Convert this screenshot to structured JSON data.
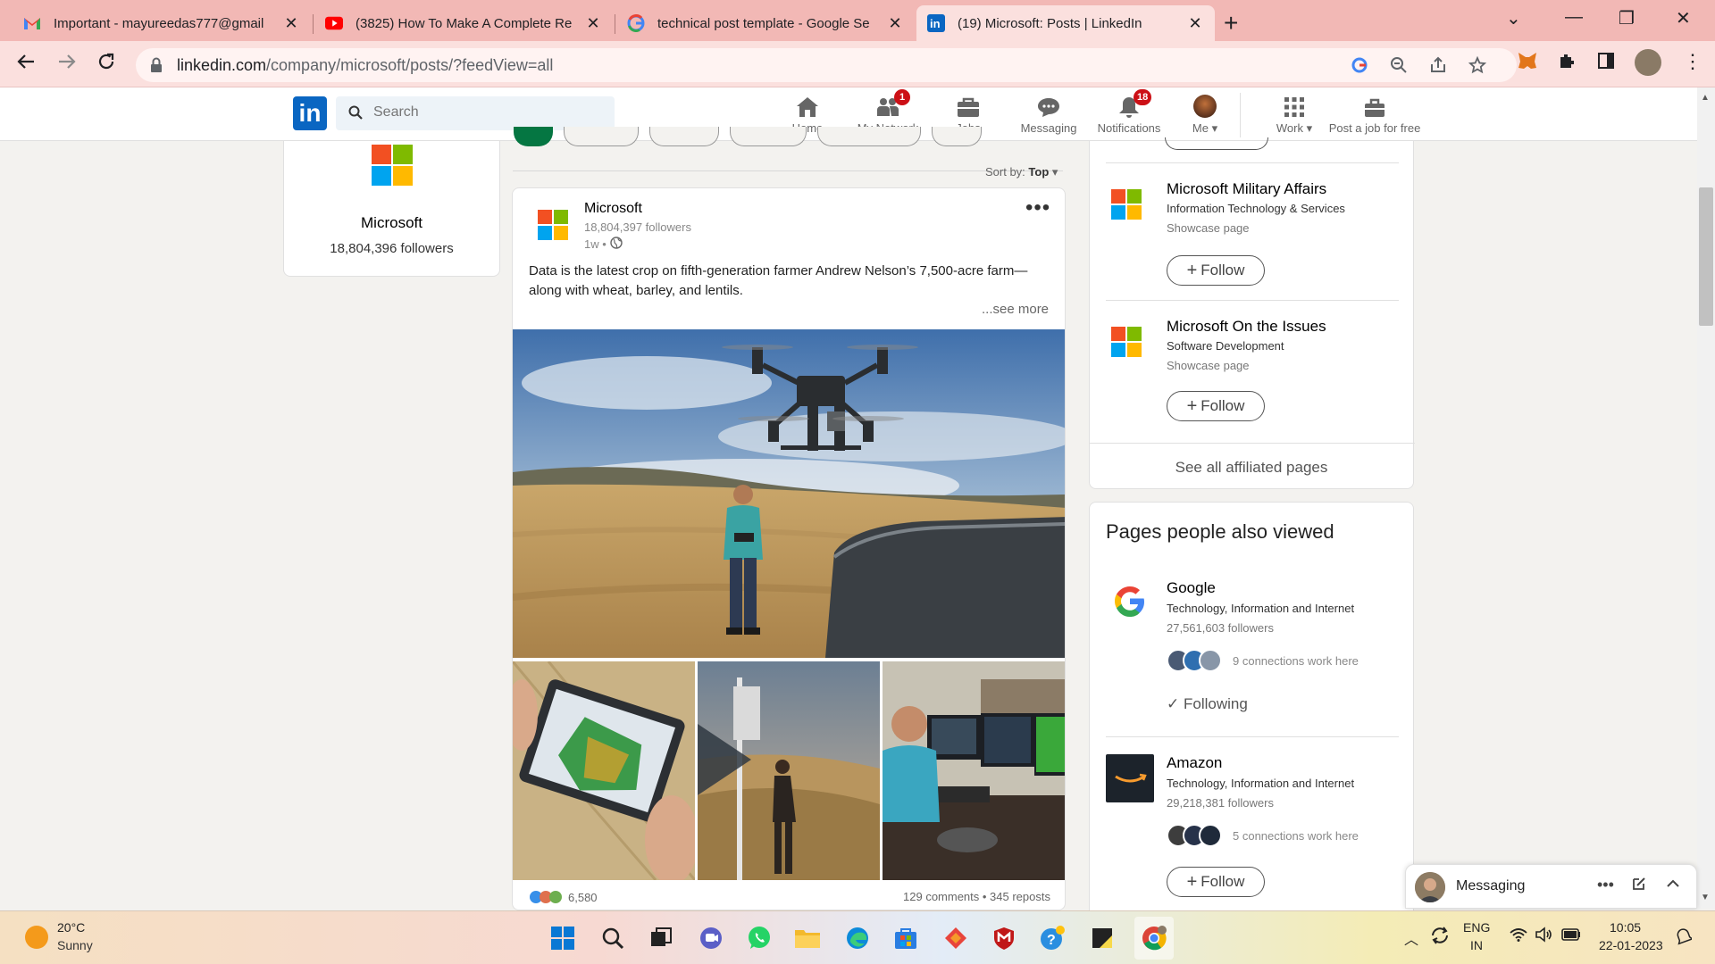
{
  "browser": {
    "tabs": [
      {
        "title": "Important - mayureedas777@gmail",
        "icon": "gmail-icon"
      },
      {
        "title": "(3825) How To Make A Complete Re",
        "icon": "youtube-icon"
      },
      {
        "title": "technical post template - Google Se",
        "icon": "google-icon"
      },
      {
        "title": "(19) Microsoft: Posts | LinkedIn",
        "icon": "linkedin-icon",
        "active": true
      }
    ],
    "url_host": "linkedin.com",
    "url_path": "/company/microsoft/posts/?feedView=all"
  },
  "linkedin": {
    "search_placeholder": "Search",
    "nav": [
      {
        "label": "Home",
        "icon": "home-icon"
      },
      {
        "label": "My Network",
        "icon": "network-icon",
        "badge": "1"
      },
      {
        "label": "Jobs",
        "icon": "jobs-icon"
      },
      {
        "label": "Messaging",
        "icon": "messaging-icon"
      },
      {
        "label": "Notifications",
        "icon": "bell-icon",
        "badge": "18"
      },
      {
        "label": "Me",
        "icon": "avatar"
      },
      {
        "label": "Work",
        "icon": "grid-icon"
      },
      {
        "label": "Post a job for free",
        "icon": "briefcase-icon"
      }
    ]
  },
  "company": {
    "name": "Microsoft",
    "followers": "18,804,396 followers"
  },
  "feed": {
    "sort_label": "Sort by:",
    "sort_value": "Top"
  },
  "post": {
    "author": "Microsoft",
    "followers": "18,804,397 followers",
    "time": "1w •",
    "text": "Data is the latest crop on fifth-generation farmer Andrew Nelson’s 7,500-acre farm—along with wheat, barley, and lentils.",
    "see_more": "...see more",
    "reactions": "6,580",
    "stats": "129 comments • 345 reposts"
  },
  "affiliated": {
    "items": [
      {
        "name": "Microsoft Military Affairs",
        "category": "Information Technology & Services",
        "type": "Showcase page",
        "button": "Follow"
      },
      {
        "name": "Microsoft On the Issues",
        "category": "Software Development",
        "type": "Showcase page",
        "button": "Follow"
      }
    ],
    "see_all": "See all affiliated pages"
  },
  "also_viewed": {
    "title": "Pages people also viewed",
    "items": [
      {
        "name": "Google",
        "category": "Technology, Information and Internet",
        "followers": "27,561,603 followers",
        "connections": "9 connections work here",
        "button": "Following"
      },
      {
        "name": "Amazon",
        "category": "Technology, Information and Internet",
        "followers": "29,218,381 followers",
        "connections": "5 connections work here",
        "button": "Follow"
      }
    ]
  },
  "messaging": {
    "label": "Messaging"
  },
  "taskbar": {
    "temp": "20°C",
    "weather": "Sunny",
    "lang1": "ENG",
    "lang2": "IN",
    "time": "10:05",
    "date": "22-01-2023"
  },
  "colors": {
    "linkedin_blue": "#0a66c2",
    "tabbar": "#f2b8b5",
    "ms_red": "#f25022",
    "ms_green": "#7fba00",
    "ms_blue": "#00a4ef",
    "ms_yellow": "#ffb900"
  }
}
